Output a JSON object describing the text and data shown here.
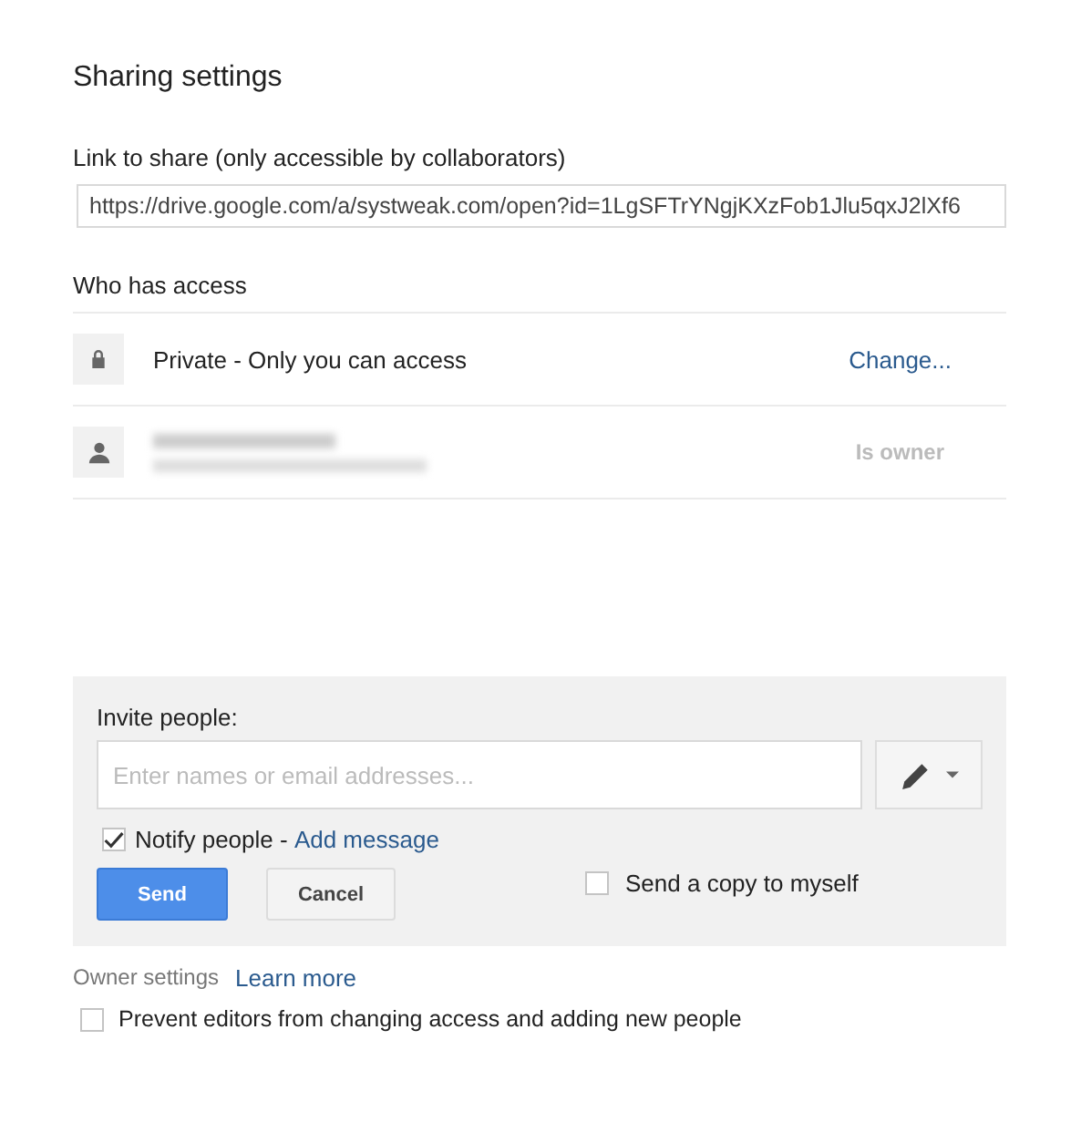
{
  "dialog": {
    "title": "Sharing settings"
  },
  "link": {
    "label": "Link to share (only accessible by collaborators)",
    "value": "https://drive.google.com/a/systweak.com/open?id=1LgSFTrYNgjKXzFob1Jlu5qxJ2lXf6"
  },
  "access": {
    "heading": "Who has access",
    "rows": [
      {
        "kind": "setting",
        "text": "Private - Only you can access",
        "action": "Change..."
      },
      {
        "kind": "person",
        "status": "Is owner"
      }
    ]
  },
  "invite": {
    "label": "Invite people:",
    "placeholder": "Enter names or email addresses...",
    "notify": {
      "checked": true,
      "label": "Notify people - ",
      "link": "Add message"
    },
    "buttons": [
      {
        "label": "Send",
        "kind": "primary"
      },
      {
        "label": "Cancel",
        "kind": "secondary"
      }
    ],
    "copy": {
      "checked": false,
      "label": "Send a copy to myself"
    }
  },
  "owner": {
    "label": "Owner settings",
    "link": "Learn more",
    "option": {
      "checked": false,
      "label": "Prevent editors from changing access and adding new people"
    }
  }
}
